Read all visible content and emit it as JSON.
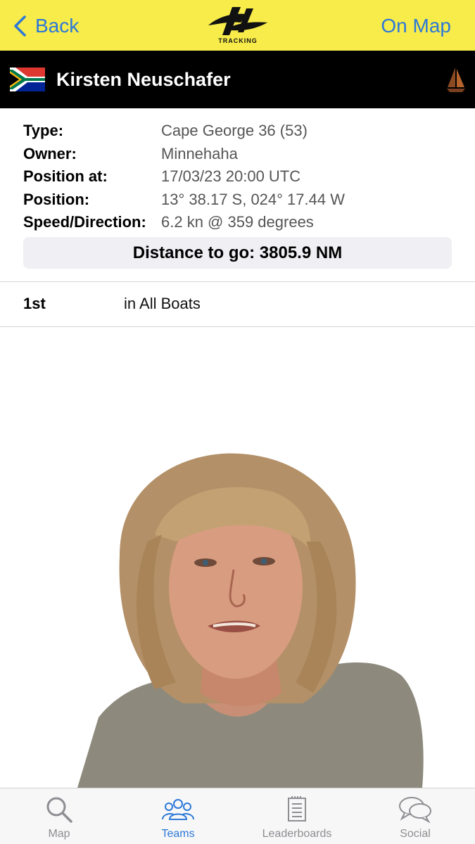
{
  "nav": {
    "back_label": "Back",
    "logo_text": "TRACKING",
    "on_map_label": "On Map"
  },
  "header": {
    "name": "Kirsten Neuschafer",
    "flag_icon": "south-africa-flag-icon",
    "boat_icon": "sail-icon"
  },
  "details": {
    "type_label": "Type:",
    "type_value": "Cape George 36 (53)",
    "owner_label": "Owner:",
    "owner_value": "Minnehaha",
    "position_at_label": "Position at:",
    "position_at_value": "17/03/23 20:00 UTC",
    "position_label": "Position:",
    "position_value": "13° 38.17 S, 024° 17.44 W",
    "speed_label": "Speed/Direction:",
    "speed_value": "6.2 kn @ 359 degrees",
    "distance": "Distance to go: 3805.9 NM"
  },
  "ranking": {
    "rank": "1st",
    "category": "in All Boats"
  },
  "tabs": [
    {
      "label": "Map",
      "icon": "search-icon",
      "active": false
    },
    {
      "label": "Teams",
      "icon": "teams-icon",
      "active": true
    },
    {
      "label": "Leaderboards",
      "icon": "leaderboards-icon",
      "active": false
    },
    {
      "label": "Social",
      "icon": "chat-bubbles-icon",
      "active": false
    }
  ],
  "colors": {
    "nav_bg": "#f8ec4a",
    "accent": "#2b78d8",
    "header_bg": "#000000"
  }
}
